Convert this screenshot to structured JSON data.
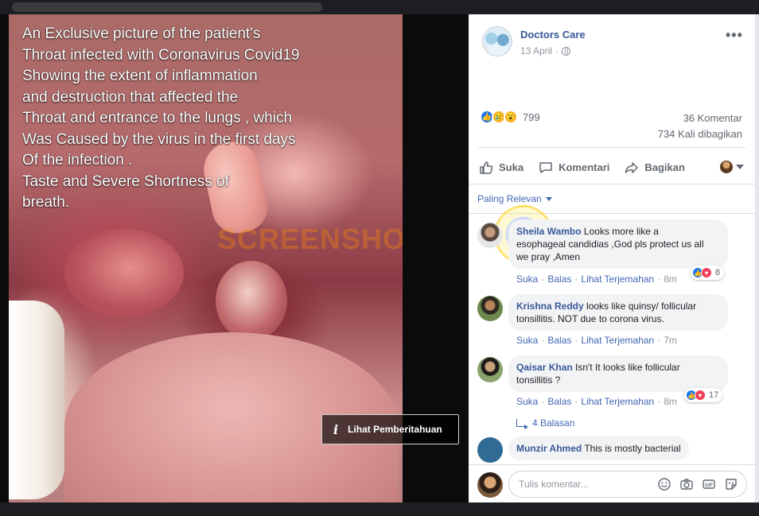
{
  "page": {
    "name": "Doctors Care",
    "date": "13 April"
  },
  "post": {
    "caption_lines": [
      "An Exclusive picture of the patient's",
      "Throat infected with Coronavirus Covid19",
      "Showing the extent of inflammation",
      "and destruction that affected the",
      "Throat  and entrance to the lungs , which",
      "Was Caused by the virus in the first days",
      "Of the infection .",
      "Taste and Severe Shortness of",
      "breath."
    ],
    "watermark": "SCREENSHOT BY",
    "notice_button": "Lihat Pemberitahuan"
  },
  "stats": {
    "reaction_count": "799",
    "comments": "36 Komentar",
    "shares": "734 Kali dibagikan"
  },
  "actions": {
    "like": "Suka",
    "comment": "Komentari",
    "share": "Bagikan"
  },
  "sort": {
    "label": "Paling Relevan"
  },
  "comment_actions": {
    "like": "Suka",
    "reply": "Balas",
    "translate": "Lihat Terjemahan"
  },
  "comments": [
    {
      "name": "Sheila Wambo",
      "text_lines": [
        "Looks more like a",
        "esophageal candidias ,God pls protect us all",
        "we pray ,Amen"
      ],
      "time": "8m",
      "reactions": "8"
    },
    {
      "name": "Krishna Reddy",
      "text_lines": [
        "looks like quinsy/ follicular",
        "tonsillitis. NOT due to corona virus."
      ],
      "time": "7m",
      "reactions": ""
    },
    {
      "name": "Qaisar Khan",
      "text_lines": [
        "Isn't It looks like follicular",
        "tonsillitis ?"
      ],
      "time": "8m",
      "reactions": "17"
    },
    {
      "name": "Munzir Ahmed",
      "text_lines": [
        "This is mostly bacterial"
      ],
      "time": "",
      "reactions": ""
    }
  ],
  "replies": {
    "label": "4 Balasan"
  },
  "composer": {
    "placeholder": "Tulis komentar..."
  },
  "colors": {
    "fb_blue": "#4267b2",
    "name_blue": "#385898",
    "like_blue": "#1877f2",
    "love_red": "#f33e58"
  }
}
